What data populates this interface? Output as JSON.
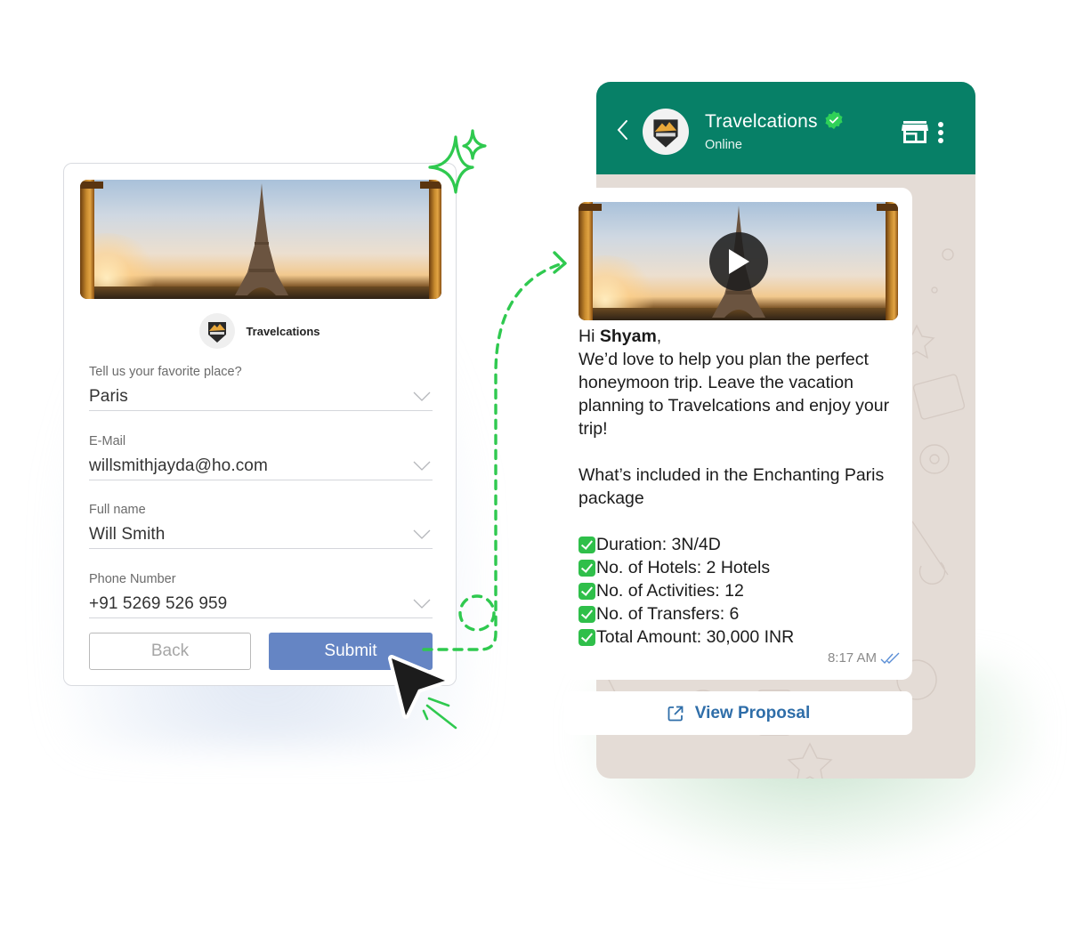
{
  "form": {
    "brand_name": "Travelcations",
    "fields": [
      {
        "label": "Tell us your favorite place?",
        "value": "Paris"
      },
      {
        "label": "E-Mail",
        "value": "willsmithjayda@ho.com"
      },
      {
        "label": "Full name",
        "value": "Will Smith"
      },
      {
        "label": "Phone Number",
        "value": "+91 5269 526 959"
      }
    ],
    "back_label": "Back",
    "submit_label": "Submit"
  },
  "chat": {
    "header": {
      "title": "Travelcations",
      "status": "Online",
      "verified": true
    },
    "message": {
      "greeting_prefix": "Hi ",
      "recipient_name": "Shyam",
      "greeting_suffix": ",",
      "intro": "We’d love to help you plan the perfect honeymoon trip. Leave the vacation planning to Travelcations and enjoy your trip!",
      "package_heading": "What’s included in the Enchanting Paris package",
      "items": [
        "Duration: 3N/4D",
        "No. of Hotels: 2 Hotels",
        "No. of Activities: 12",
        "No. of Transfers: 6",
        "Total Amount: 30,000 INR"
      ],
      "time": "8:17 AM",
      "read_status": "read"
    },
    "cta_label": "View Proposal"
  },
  "colors": {
    "whatsapp_header": "#078067",
    "submit_button": "#6585c4",
    "accent_green": "#2fc94f",
    "cta_text": "#2f6ea9",
    "chat_background": "#e4dcd6"
  },
  "icons": {
    "sparkle": "sparkle-icon",
    "flow_arrow": "dashed-arrow-icon",
    "cursor": "cursor-pointer-icon",
    "back": "chevron-left-icon",
    "verified": "verified-badge-icon",
    "store": "store-icon",
    "more": "more-vertical-icon",
    "play": "play-icon",
    "external_link": "external-link-icon",
    "double_check": "double-check-icon"
  }
}
